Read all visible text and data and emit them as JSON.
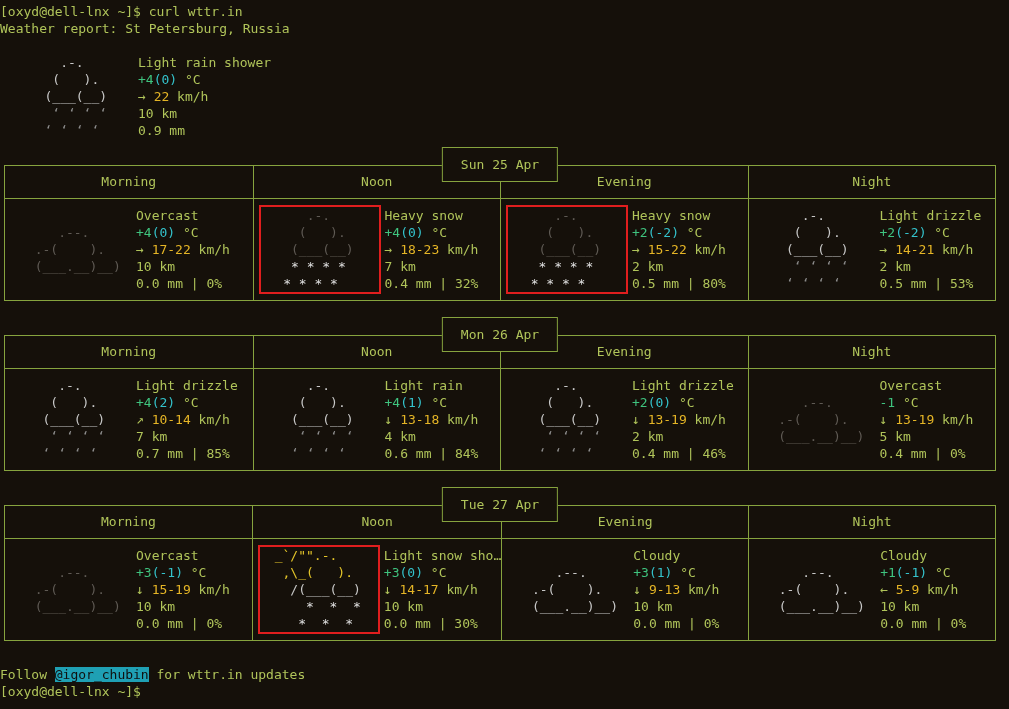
{
  "prompt": "[oxyd@dell-lnx ~]$ curl wttr.in",
  "report_title": "Weather report: St Petersburg, Russia",
  "current": {
    "kind": "rain",
    "art": [
      "     .-.",
      "    (   ).",
      "   (___(__)",
      "    ‘ ‘ ‘ ‘",
      "   ‘ ‘ ‘ ‘"
    ],
    "condition": "Light rain shower",
    "temp": "+4",
    "feels": "(0)",
    "temp_unit": "°C",
    "wind_dir": "→",
    "wind_speed": "22",
    "wind_unit": "km/h",
    "visibility": "10 km",
    "precipitation": "0.9 mm"
  },
  "days": [
    {
      "date": "Sun 25 Apr",
      "periods": [
        "Morning",
        "Noon",
        "Evening",
        "Night"
      ],
      "cells": [
        {
          "kind": "overcast",
          "highlighted": false,
          "art": [
            "     .--.",
            "  .-(    ).",
            "  (___.__)__)"
          ],
          "condition": "Overcast",
          "temp": "+4",
          "feels": "(0)",
          "temp_unit": "°C",
          "wind_dir": "→",
          "wind_speed": "17-22",
          "wind_unit": "km/h",
          "visibility": "10 km",
          "precipitation": "0.0 mm | 0%"
        },
        {
          "kind": "snow",
          "highlighted": true,
          "art": [
            "     .-.",
            "    (   ).",
            "   (___(__)",
            "   * * * *",
            "  * * * *"
          ],
          "condition": "Heavy snow",
          "temp": "+4",
          "feels": "(0)",
          "temp_unit": "°C",
          "wind_dir": "→",
          "wind_speed": "18-23",
          "wind_unit": "km/h",
          "visibility": "7 km",
          "precipitation": "0.4 mm | 32%"
        },
        {
          "kind": "snow",
          "highlighted": true,
          "art": [
            "     .-.",
            "    (   ).",
            "   (___(__)",
            "   * * * *",
            "  * * * *"
          ],
          "condition": "Heavy snow",
          "temp": "+2",
          "feels": "(-2)",
          "temp_unit": "°C",
          "wind_dir": "→",
          "wind_speed": "15-22",
          "wind_unit": "km/h",
          "visibility": "2 km",
          "precipitation": "0.5 mm | 80%"
        },
        {
          "kind": "rain",
          "highlighted": false,
          "art": [
            "     .-.",
            "    (   ).",
            "   (___(__)",
            "    ‘ ‘ ‘ ‘",
            "   ‘ ‘ ‘ ‘"
          ],
          "condition": "Light drizzle",
          "temp": "+2",
          "feels": "(-2)",
          "temp_unit": "°C",
          "wind_dir": "→",
          "wind_speed": "14-21",
          "wind_unit": "km/h",
          "visibility": "2 km",
          "precipitation": "0.5 mm | 53%"
        }
      ]
    },
    {
      "date": "Mon 26 Apr",
      "periods": [
        "Morning",
        "Noon",
        "Evening",
        "Night"
      ],
      "cells": [
        {
          "kind": "rain",
          "highlighted": false,
          "art": [
            "     .-.",
            "    (   ).",
            "   (___(__)",
            "    ‘ ‘ ‘ ‘",
            "   ‘ ‘ ‘ ‘"
          ],
          "condition": "Light drizzle",
          "temp": "+4",
          "feels": "(2)",
          "temp_unit": "°C",
          "wind_dir": "↗",
          "wind_speed": "10-14",
          "wind_unit": "km/h",
          "visibility": "7 km",
          "precipitation": "0.7 mm | 85%"
        },
        {
          "kind": "rain",
          "highlighted": false,
          "art": [
            "     .-.",
            "    (   ).",
            "   (___(__)",
            "    ‘ ‘ ‘ ‘",
            "   ‘ ‘ ‘ ‘"
          ],
          "condition": "Light rain",
          "temp": "+4",
          "feels": "(1)",
          "temp_unit": "°C",
          "wind_dir": "↓",
          "wind_speed": "13-18",
          "wind_unit": "km/h",
          "visibility": "4 km",
          "precipitation": "0.6 mm | 84%"
        },
        {
          "kind": "rain",
          "highlighted": false,
          "art": [
            "     .-.",
            "    (   ).",
            "   (___(__)",
            "    ‘ ‘ ‘ ‘",
            "   ‘ ‘ ‘ ‘"
          ],
          "condition": "Light drizzle",
          "temp": "+2",
          "feels": "(0)",
          "temp_unit": "°C",
          "wind_dir": "↓",
          "wind_speed": "13-19",
          "wind_unit": "km/h",
          "visibility": "2 km",
          "precipitation": "0.4 mm | 46%"
        },
        {
          "kind": "overcast",
          "highlighted": false,
          "art": [
            "     .--.",
            "  .-(    ).",
            "  (___.__)__)"
          ],
          "condition": "Overcast",
          "temp": "-1",
          "temp_unit": "°C",
          "wind_dir": "↓",
          "wind_speed": "13-19",
          "wind_unit": "km/h",
          "visibility": "5 km",
          "precipitation": "0.4 mm | 0%"
        }
      ]
    },
    {
      "date": "Tue 27 Apr",
      "periods": [
        "Morning",
        "Noon",
        "Evening",
        "Night"
      ],
      "cells": [
        {
          "kind": "overcast",
          "highlighted": false,
          "art": [
            "     .--.",
            "  .-(    ).",
            "  (___.__)__)"
          ],
          "condition": "Overcast",
          "temp": "+3",
          "feels": "(-1)",
          "temp_unit": "°C",
          "wind_dir": "↓",
          "wind_speed": "15-19",
          "wind_unit": "km/h",
          "visibility": "10 km",
          "precipitation": "0.0 mm | 0%"
        },
        {
          "kind": "snow_shower",
          "highlighted": true,
          "art": [
            " _`/\"\".-.",
            "  ,\\_(   ).",
            "   /(___(__)",
            "     *  *  *",
            "    *  *  *"
          ],
          "condition": "Light snow sho…",
          "temp": "+3",
          "feels": "(0)",
          "temp_unit": "°C",
          "wind_dir": "↓",
          "wind_speed": "14-17",
          "wind_unit": "km/h",
          "visibility": "10 km",
          "precipitation": "0.0 mm | 30%"
        },
        {
          "kind": "cloudy",
          "highlighted": false,
          "art": [
            "     .--.",
            "  .-(    ).",
            "  (___.__)__)"
          ],
          "condition": "Cloudy",
          "temp": "+3",
          "feels": "(1)",
          "temp_unit": "°C",
          "wind_dir": "↓",
          "wind_speed": "9-13",
          "wind_unit": "km/h",
          "visibility": "10 km",
          "precipitation": "0.0 mm | 0%"
        },
        {
          "kind": "cloudy",
          "highlighted": false,
          "art": [
            "     .--.",
            "  .-(    ).",
            "  (___.__)__)"
          ],
          "condition": "Cloudy",
          "temp": "+1",
          "feels": "(-1)",
          "temp_unit": "°C",
          "wind_dir": "←",
          "wind_speed": "5-9",
          "wind_unit": "km/h",
          "visibility": "10 km",
          "precipitation": "0.0 mm | 0%"
        }
      ]
    }
  ],
  "footer": {
    "before": "Follow",
    "link": "@igor_chubin",
    "after": "for wttr.in updates"
  },
  "final_prompt": "[oxyd@dell-lnx ~]$"
}
